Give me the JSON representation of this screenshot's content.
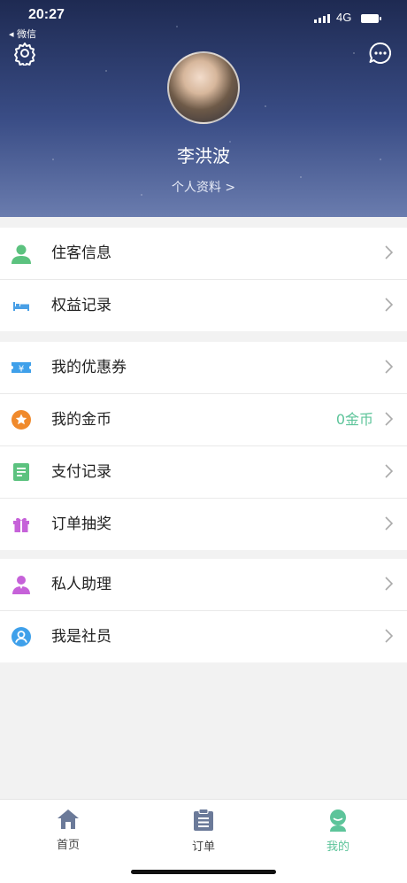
{
  "status": {
    "time": "20:27",
    "back_app": "◂ 微信",
    "network": "4G"
  },
  "header": {
    "name": "李洪波",
    "profile_link": "个人资料 >"
  },
  "groups": [
    {
      "items": [
        {
          "label": "住客信息",
          "value": ""
        },
        {
          "label": "权益记录",
          "value": ""
        }
      ]
    },
    {
      "items": [
        {
          "label": "我的优惠券",
          "value": ""
        },
        {
          "label": "我的金币",
          "value": "0金币"
        },
        {
          "label": "支付记录",
          "value": ""
        },
        {
          "label": "订单抽奖",
          "value": ""
        }
      ]
    },
    {
      "items": [
        {
          "label": "私人助理",
          "value": ""
        },
        {
          "label": "我是社员",
          "value": ""
        }
      ]
    }
  ],
  "tabbar": [
    {
      "label": "首页",
      "active": false
    },
    {
      "label": "订单",
      "active": false
    },
    {
      "label": "我的",
      "active": true
    }
  ],
  "colors": {
    "accent": "#5dc49a",
    "inactive_tab": "#6b7a99",
    "header_dark": "#1e2a52"
  }
}
